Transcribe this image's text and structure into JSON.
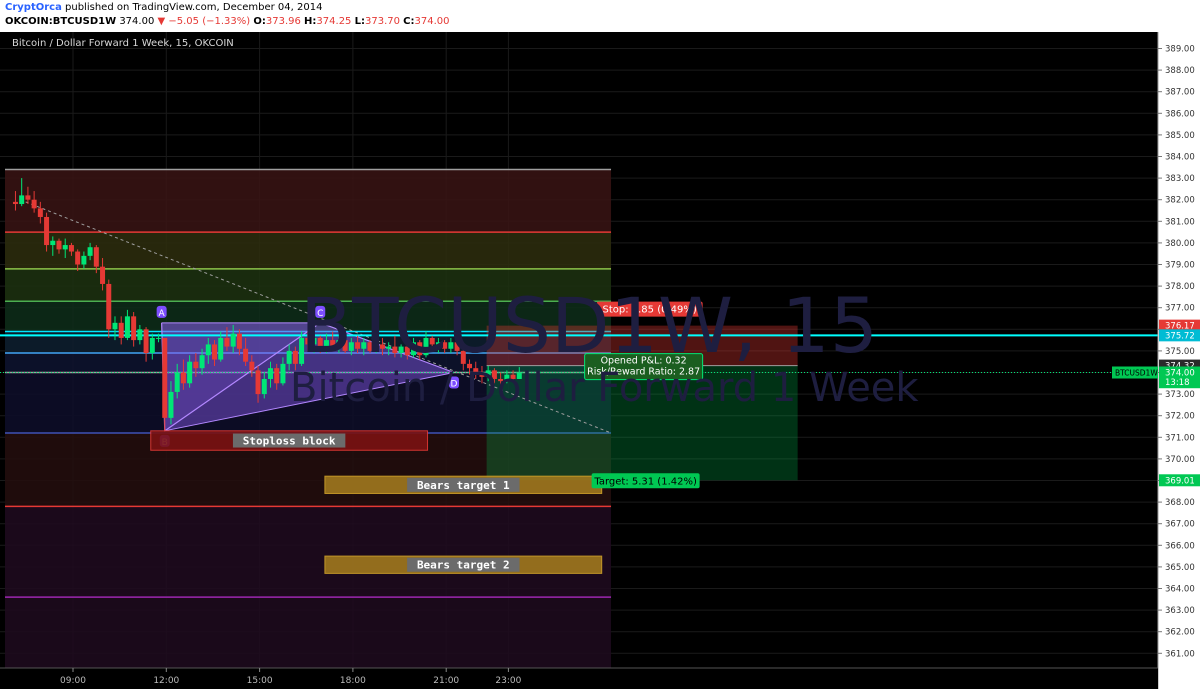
{
  "header": {
    "author": "CryptOrca",
    "published": " published on TradingView.com, December 04, 2014",
    "symbol": "OKCOIN:BTCUSD1W",
    "last": "374.00",
    "change": "−5.05 (−1.33%)",
    "open_label": "O:",
    "open": "373.96",
    "high_label": "H:",
    "high": "374.25",
    "low_label": "L:",
    "low": "373.70",
    "close_label": "C:",
    "close": "374.00"
  },
  "chart_title": "Bitcoin / Dollar Forward 1 Week, 15, OKCOIN",
  "watermark": {
    "line1": "BTCUSD1W, 15",
    "line2": "Bitcoin / Dollar Forward 1 Week"
  },
  "colors": {
    "up": "#00e676",
    "down": "#e53935",
    "accent": "#2962ff",
    "pattern": "#8a5cf0",
    "cyan": "#00ffff"
  },
  "price_axis": {
    "ticks": [
      "389.00",
      "388.00",
      "387.00",
      "386.00",
      "385.00",
      "384.00",
      "383.00",
      "382.00",
      "381.00",
      "380.00",
      "379.00",
      "378.00",
      "377.00",
      "376.00",
      "375.00",
      "374.00",
      "373.00",
      "372.00",
      "371.00",
      "370.00",
      "369.00",
      "368.00",
      "367.00",
      "366.00",
      "365.00",
      "364.00",
      "363.00",
      "362.00",
      "361.00"
    ],
    "tags": [
      {
        "text": "376.17",
        "price": 376.17,
        "color": "#e53935"
      },
      {
        "text": "375.72",
        "price": 375.72,
        "color": "#00bcd4"
      },
      {
        "text": "374.32",
        "price": 374.32,
        "color": "#2a2a2a"
      },
      {
        "text": "374.00",
        "price": 374.0,
        "color": "#00c853"
      },
      {
        "text": "13:18",
        "price": 373.55,
        "color": "#00c853"
      },
      {
        "text": "369.01",
        "price": 369.01,
        "color": "#00c853"
      }
    ],
    "symbol_tag": "BTCUSD1W"
  },
  "time_axis": {
    "labels": [
      {
        "text": "09:00",
        "time": 9.0
      },
      {
        "text": "12:00",
        "time": 12.0
      },
      {
        "text": "15:00",
        "time": 15.0
      },
      {
        "text": "18:00",
        "time": 18.0
      },
      {
        "text": "21:00",
        "time": 21.0
      },
      {
        "text": "23:00",
        "time": 23.0
      }
    ]
  },
  "chart_data": {
    "type": "candlestick",
    "y_range": [
      360.0,
      389.5
    ],
    "x_range_hours": [
      7.0,
      29.5
    ],
    "candles": [
      {
        "t": 7.15,
        "o": 381.9,
        "h": 382.4,
        "l": 381.5,
        "c": 381.8
      },
      {
        "t": 7.35,
        "o": 381.8,
        "h": 383.0,
        "l": 381.7,
        "c": 382.2
      },
      {
        "t": 7.55,
        "o": 382.2,
        "h": 382.6,
        "l": 381.8,
        "c": 382.0
      },
      {
        "t": 7.75,
        "o": 382.0,
        "h": 382.4,
        "l": 381.4,
        "c": 381.6
      },
      {
        "t": 7.95,
        "o": 381.6,
        "h": 381.9,
        "l": 380.9,
        "c": 381.2
      },
      {
        "t": 8.15,
        "o": 381.2,
        "h": 381.4,
        "l": 379.6,
        "c": 379.9
      },
      {
        "t": 8.35,
        "o": 379.9,
        "h": 380.3,
        "l": 379.4,
        "c": 380.1
      },
      {
        "t": 8.55,
        "o": 380.1,
        "h": 380.2,
        "l": 379.5,
        "c": 379.7
      },
      {
        "t": 8.75,
        "o": 379.7,
        "h": 380.2,
        "l": 379.3,
        "c": 379.9
      },
      {
        "t": 8.95,
        "o": 379.9,
        "h": 380.0,
        "l": 379.4,
        "c": 379.6
      },
      {
        "t": 9.15,
        "o": 379.6,
        "h": 379.7,
        "l": 378.7,
        "c": 379.0
      },
      {
        "t": 9.35,
        "o": 379.0,
        "h": 379.6,
        "l": 378.8,
        "c": 379.4
      },
      {
        "t": 9.55,
        "o": 379.4,
        "h": 380.0,
        "l": 379.2,
        "c": 379.8
      },
      {
        "t": 9.75,
        "o": 379.8,
        "h": 379.9,
        "l": 378.6,
        "c": 378.9
      },
      {
        "t": 9.95,
        "o": 378.9,
        "h": 379.3,
        "l": 377.8,
        "c": 378.1
      },
      {
        "t": 10.15,
        "o": 378.1,
        "h": 378.3,
        "l": 375.6,
        "c": 376.0
      },
      {
        "t": 10.35,
        "o": 376.0,
        "h": 376.6,
        "l": 375.5,
        "c": 376.3
      },
      {
        "t": 10.55,
        "o": 376.3,
        "h": 376.6,
        "l": 375.3,
        "c": 375.6
      },
      {
        "t": 10.75,
        "o": 375.6,
        "h": 376.9,
        "l": 375.5,
        "c": 376.6
      },
      {
        "t": 10.95,
        "o": 376.6,
        "h": 376.8,
        "l": 375.2,
        "c": 375.5
      },
      {
        "t": 11.15,
        "o": 375.5,
        "h": 376.2,
        "l": 375.3,
        "c": 376.0
      },
      {
        "t": 11.35,
        "o": 376.0,
        "h": 376.1,
        "l": 374.5,
        "c": 374.9
      },
      {
        "t": 11.55,
        "o": 374.9,
        "h": 375.8,
        "l": 374.6,
        "c": 375.6
      },
      {
        "t": 11.75,
        "o": 375.6,
        "h": 375.8,
        "l": 375.4,
        "c": 375.6
      },
      {
        "t": 11.95,
        "o": 375.6,
        "h": 375.6,
        "l": 371.3,
        "c": 371.9
      },
      {
        "t": 12.15,
        "o": 371.9,
        "h": 373.6,
        "l": 371.6,
        "c": 373.1
      },
      {
        "t": 12.35,
        "o": 373.1,
        "h": 374.4,
        "l": 372.8,
        "c": 374.0
      },
      {
        "t": 12.55,
        "o": 374.0,
        "h": 374.6,
        "l": 373.2,
        "c": 373.5
      },
      {
        "t": 12.75,
        "o": 373.5,
        "h": 374.8,
        "l": 373.3,
        "c": 374.5
      },
      {
        "t": 12.95,
        "o": 374.5,
        "h": 374.9,
        "l": 373.8,
        "c": 374.2
      },
      {
        "t": 13.15,
        "o": 374.2,
        "h": 375.1,
        "l": 373.9,
        "c": 374.8
      },
      {
        "t": 13.35,
        "o": 374.8,
        "h": 375.6,
        "l": 374.4,
        "c": 375.3
      },
      {
        "t": 13.55,
        "o": 375.3,
        "h": 375.5,
        "l": 374.3,
        "c": 374.6
      },
      {
        "t": 13.75,
        "o": 374.6,
        "h": 375.9,
        "l": 374.5,
        "c": 375.6
      },
      {
        "t": 13.95,
        "o": 375.6,
        "h": 376.1,
        "l": 375.0,
        "c": 375.2
      },
      {
        "t": 14.15,
        "o": 375.2,
        "h": 376.2,
        "l": 374.9,
        "c": 375.8
      },
      {
        "t": 14.35,
        "o": 375.8,
        "h": 376.0,
        "l": 374.8,
        "c": 375.1
      },
      {
        "t": 14.55,
        "o": 375.1,
        "h": 375.6,
        "l": 374.3,
        "c": 374.5
      },
      {
        "t": 14.75,
        "o": 374.5,
        "h": 374.8,
        "l": 373.8,
        "c": 374.1
      },
      {
        "t": 14.95,
        "o": 374.1,
        "h": 374.3,
        "l": 372.6,
        "c": 373.0
      },
      {
        "t": 15.15,
        "o": 373.0,
        "h": 374.0,
        "l": 372.8,
        "c": 373.7
      },
      {
        "t": 15.35,
        "o": 373.7,
        "h": 374.5,
        "l": 373.3,
        "c": 374.2
      },
      {
        "t": 15.55,
        "o": 374.2,
        "h": 374.4,
        "l": 373.2,
        "c": 373.5
      },
      {
        "t": 15.75,
        "o": 373.5,
        "h": 374.7,
        "l": 373.4,
        "c": 374.4
      },
      {
        "t": 15.95,
        "o": 374.4,
        "h": 375.3,
        "l": 374.1,
        "c": 375.0
      },
      {
        "t": 16.15,
        "o": 375.0,
        "h": 375.2,
        "l": 374.1,
        "c": 374.4
      },
      {
        "t": 16.35,
        "o": 374.4,
        "h": 375.9,
        "l": 374.3,
        "c": 375.6
      },
      {
        "t": 16.55,
        "o": 375.6,
        "h": 375.9,
        "l": 375.0,
        "c": 375.3
      },
      {
        "t": 16.75,
        "o": 375.3,
        "h": 375.8,
        "l": 374.9,
        "c": 375.6
      },
      {
        "t": 16.95,
        "o": 375.6,
        "h": 375.7,
        "l": 374.9,
        "c": 375.1
      },
      {
        "t": 17.15,
        "o": 375.1,
        "h": 375.8,
        "l": 374.9,
        "c": 375.5
      },
      {
        "t": 17.35,
        "o": 375.5,
        "h": 375.9,
        "l": 375.0,
        "c": 375.2
      },
      {
        "t": 17.55,
        "o": 375.2,
        "h": 375.7,
        "l": 374.9,
        "c": 375.5
      },
      {
        "t": 17.75,
        "o": 375.5,
        "h": 375.6,
        "l": 374.9,
        "c": 375.0
      },
      {
        "t": 17.95,
        "o": 375.0,
        "h": 375.6,
        "l": 374.8,
        "c": 375.4
      },
      {
        "t": 18.15,
        "o": 375.4,
        "h": 375.7,
        "l": 374.9,
        "c": 375.1
      },
      {
        "t": 18.35,
        "o": 375.1,
        "h": 375.6,
        "l": 374.8,
        "c": 375.4
      },
      {
        "t": 18.55,
        "o": 375.4,
        "h": 375.5,
        "l": 374.9,
        "c": 375.0
      },
      {
        "t": 18.75,
        "o": 375.0,
        "h": 375.5,
        "l": 374.9,
        "c": 375.3
      },
      {
        "t": 18.95,
        "o": 375.3,
        "h": 375.6,
        "l": 374.8,
        "c": 375.1
      },
      {
        "t": 19.15,
        "o": 375.1,
        "h": 375.4,
        "l": 374.8,
        "c": 375.2
      },
      {
        "t": 19.35,
        "o": 375.2,
        "h": 375.7,
        "l": 374.7,
        "c": 374.9
      },
      {
        "t": 19.55,
        "o": 374.9,
        "h": 375.3,
        "l": 374.7,
        "c": 375.2
      },
      {
        "t": 19.75,
        "o": 375.2,
        "h": 375.3,
        "l": 374.6,
        "c": 374.8
      },
      {
        "t": 19.95,
        "o": 374.8,
        "h": 375.6,
        "l": 374.7,
        "c": 375.4
      },
      {
        "t": 20.15,
        "o": 375.4,
        "h": 375.5,
        "l": 374.6,
        "c": 374.8
      },
      {
        "t": 20.35,
        "o": 374.8,
        "h": 375.9,
        "l": 374.7,
        "c": 375.6
      },
      {
        "t": 20.55,
        "o": 375.6,
        "h": 375.7,
        "l": 375.0,
        "c": 375.3
      },
      {
        "t": 20.75,
        "o": 375.3,
        "h": 375.6,
        "l": 374.9,
        "c": 375.4
      },
      {
        "t": 20.95,
        "o": 375.4,
        "h": 375.5,
        "l": 374.9,
        "c": 375.1
      },
      {
        "t": 21.15,
        "o": 375.1,
        "h": 375.6,
        "l": 374.9,
        "c": 375.4
      },
      {
        "t": 21.35,
        "o": 375.4,
        "h": 375.5,
        "l": 374.8,
        "c": 375.0
      },
      {
        "t": 21.55,
        "o": 375.0,
        "h": 375.2,
        "l": 374.1,
        "c": 374.4
      },
      {
        "t": 21.75,
        "o": 374.4,
        "h": 374.6,
        "l": 373.9,
        "c": 374.2
      },
      {
        "t": 21.95,
        "o": 374.2,
        "h": 374.5,
        "l": 373.7,
        "c": 374.0
      },
      {
        "t": 22.15,
        "o": 374.0,
        "h": 374.3,
        "l": 373.5,
        "c": 373.8
      },
      {
        "t": 22.35,
        "o": 373.8,
        "h": 374.3,
        "l": 373.6,
        "c": 374.1
      },
      {
        "t": 22.55,
        "o": 374.1,
        "h": 374.2,
        "l": 373.5,
        "c": 373.7
      },
      {
        "t": 22.75,
        "o": 373.7,
        "h": 374.0,
        "l": 373.3,
        "c": 373.6
      },
      {
        "t": 22.95,
        "o": 373.6,
        "h": 374.1,
        "l": 373.5,
        "c": 373.9
      },
      {
        "t": 23.15,
        "o": 373.9,
        "h": 374.1,
        "l": 373.6,
        "c": 373.7
      },
      {
        "t": 23.35,
        "o": 373.7,
        "h": 374.25,
        "l": 373.7,
        "c": 374.0
      }
    ],
    "fib_levels": [
      {
        "price": 383.4,
        "color": "#9e9e9e",
        "band": "#3a1414"
      },
      {
        "price": 380.5,
        "color": "#e53935",
        "band": "#2e2e0e"
      },
      {
        "price": 378.8,
        "color": "#8bc34a",
        "band": "#1d3311"
      },
      {
        "price": 377.3,
        "color": "#4caf50",
        "band": "#0e2e1a"
      },
      {
        "price": 375.9,
        "color": "#00e5ff",
        "band": "#0e2030"
      },
      {
        "price": 374.9,
        "color": "#42a5f5",
        "band": "#0e1430"
      },
      {
        "price": 374.0,
        "color": "#9e9e9e",
        "band": "#0e0e2a"
      },
      {
        "price": 371.2,
        "color": "#3f51b5",
        "band": "#240e0e"
      },
      {
        "price": 367.8,
        "color": "#e53935",
        "band": "#200a20"
      },
      {
        "price": 363.6,
        "color": "#9c27b0",
        "band": "#1e0a1e"
      }
    ],
    "cyan_line": 375.72,
    "current_price": 374.0,
    "pattern": {
      "points": [
        {
          "name": "A",
          "t": 11.85,
          "p": 376.3
        },
        {
          "name": "B",
          "t": 11.95,
          "p": 371.3
        },
        {
          "name": "C",
          "t": 16.95,
          "p": 376.3
        },
        {
          "name": "D",
          "t": 21.25,
          "p": 374.0
        }
      ]
    },
    "trendline": {
      "t1": 7.3,
      "p1": 382.0,
      "t2": 26.3,
      "p2": 371.2
    },
    "position": {
      "entry": 374.32,
      "stop": 376.17,
      "target": 369.01,
      "t_start": 22.3,
      "t_end": 32.3,
      "stop_text": "Stop: 1.85 (0.49%)",
      "target_text": "Target: 5.31 (1.42%)",
      "pl_text": "Opened P&L: 0.32",
      "rr_text": "Risk/Reward Ratio: 2.87"
    },
    "zones": [
      {
        "label": "Stoploss block",
        "t1": 11.5,
        "t2": 20.4,
        "p1": 370.4,
        "p2": 371.3,
        "fill": "#7a1212",
        "stroke": "#e53935"
      },
      {
        "label": "Bears target 1",
        "t1": 17.1,
        "t2": 26.0,
        "p1": 368.4,
        "p2": 369.2,
        "fill": "#a0781e",
        "stroke": "#d4a52a"
      },
      {
        "label": "Bears target 2",
        "t1": 17.1,
        "t2": 26.0,
        "p1": 364.7,
        "p2": 365.5,
        "fill": "#a0781e",
        "stroke": "#d4a52a"
      }
    ]
  }
}
